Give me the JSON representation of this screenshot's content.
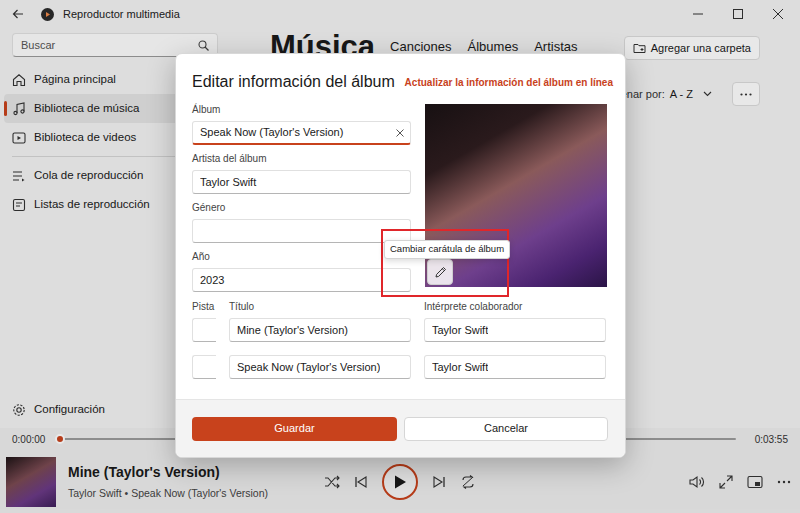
{
  "window": {
    "title": "Reproductor multimedia"
  },
  "sidebar": {
    "search": {
      "placeholder": "Buscar"
    },
    "primary_items": [
      {
        "label": "Página principal",
        "selected": false
      },
      {
        "label": "Biblioteca de música",
        "selected": true
      },
      {
        "label": "Biblioteca de videos",
        "selected": false
      }
    ],
    "secondary_items": [
      {
        "label": "Cola de reproducción",
        "selected": false
      },
      {
        "label": "Listas de reproducción",
        "selected": false
      }
    ],
    "settings": "Configuración"
  },
  "main": {
    "heading": "Música",
    "tabs": [
      {
        "label": "Canciones",
        "selected": false
      },
      {
        "label": "Álbumes",
        "selected": false
      },
      {
        "label": "Artistas",
        "selected": false
      }
    ],
    "add_folder_button": "Agregar una carpeta",
    "sort": {
      "label": "enar por:",
      "value": "A - Z"
    }
  },
  "dialog": {
    "title": "Editar información del álbum",
    "online_link": "Actualizar la información del álbum en línea",
    "fields": [
      {
        "label": "Álbum",
        "value": "Speak Now (Taylor's Version)",
        "focused": true
      },
      {
        "label": "Artista del álbum",
        "value": "Taylor Swift",
        "focused": false
      },
      {
        "label": "Género",
        "value": "",
        "focused": false
      },
      {
        "label": "Año",
        "value": "2023",
        "focused": false
      }
    ],
    "cover_tooltip": "Cambiar carátula de álbum",
    "track_columns": [
      "Pista",
      "Título",
      "Intérprete colaborador"
    ],
    "tracks": [
      {
        "number": "",
        "title": "Mine (Taylor's Version)",
        "artist": "Taylor Swift"
      },
      {
        "number": "",
        "title": "Speak Now (Taylor's Version)",
        "artist": "Taylor Swift"
      }
    ],
    "buttons": {
      "save": "Guardar",
      "cancel": "Cancelar"
    }
  },
  "player": {
    "elapsed": "0:00:00",
    "duration": "0:03:55",
    "level": 0,
    "title": "Mine (Taylor's Version)",
    "subtitle": "Taylor Swift • Speak Now (Taylor's Version)"
  }
}
